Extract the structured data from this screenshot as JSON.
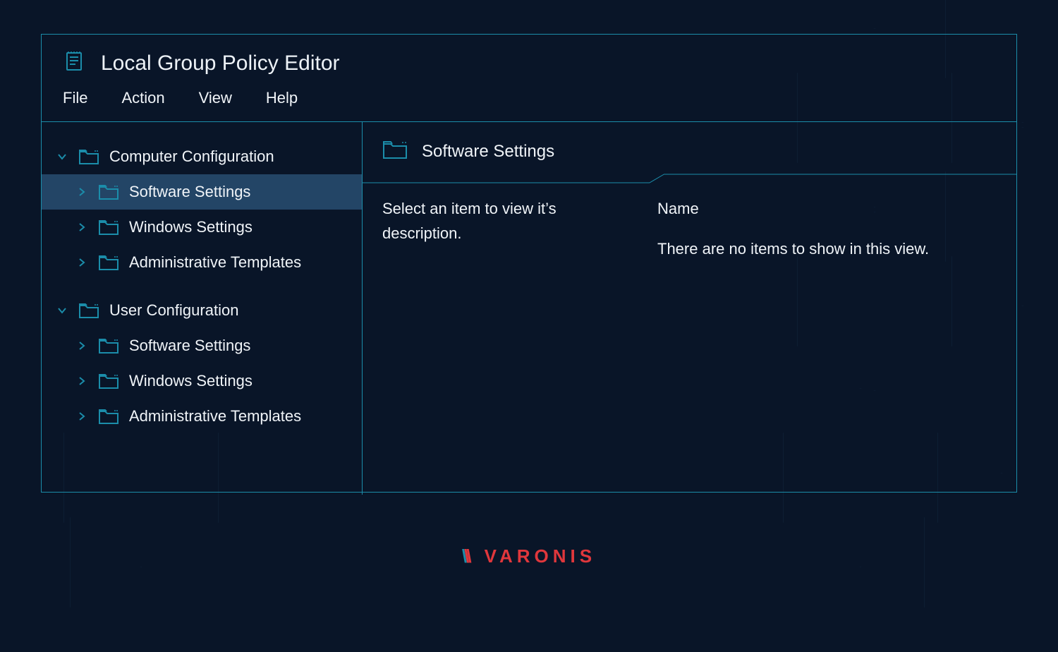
{
  "app": {
    "title": "Local Group Policy Editor"
  },
  "menu": {
    "file": "File",
    "action": "Action",
    "view": "View",
    "help": "Help"
  },
  "tree": [
    {
      "label": "Computer Configuration",
      "expanded": true,
      "selected": false,
      "children": [
        {
          "label": "Software Settings",
          "selected": true
        },
        {
          "label": "Windows Settings",
          "selected": false
        },
        {
          "label": "Administrative Templates",
          "selected": false
        }
      ]
    },
    {
      "label": "User Configuration",
      "expanded": true,
      "selected": false,
      "children": [
        {
          "label": "Software Settings",
          "selected": false
        },
        {
          "label": "Windows Settings",
          "selected": false
        },
        {
          "label": "Administrative Templates",
          "selected": false
        }
      ]
    }
  ],
  "panel": {
    "title": "Software Settings",
    "description": "Select an item to view it’s description.",
    "columnHeader": "Name",
    "emptyMessage": "There are no items to show in this view."
  },
  "brand": {
    "name": "VARONIS"
  }
}
